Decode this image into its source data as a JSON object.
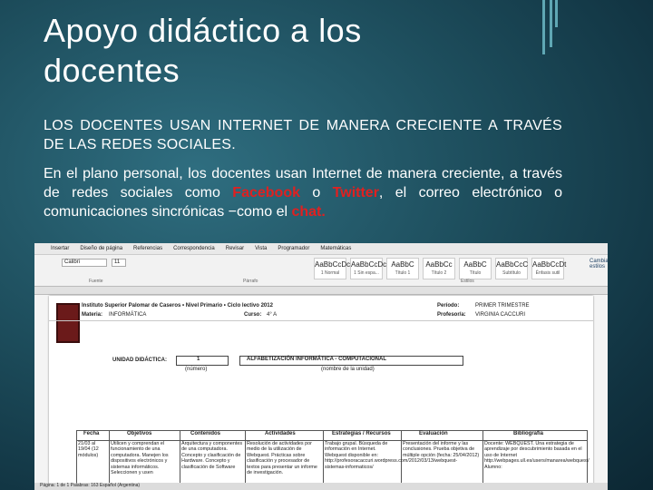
{
  "title": {
    "line1": "Apoyo didáctico a los",
    "line2": "docentes"
  },
  "paragraph1": "LOS DOCENTES USAN INTERNET DE MANERA CRECIENTE A TRAVÉS DE LAS REDES SOCIALES.",
  "paragraph2": {
    "part1": "En el plano personal, los docentes usan Internet de manera creciente, a través de redes sociales como ",
    "facebook": "Facebook",
    "part2": " o ",
    "twitter": "Twitter",
    "part3": ", el correo electrónico o comunicaciones sincrónicas −como el ",
    "chat": "chat."
  },
  "colors": {
    "accent_red": "#e02020",
    "background": "#1d4d5c"
  },
  "screenshot": {
    "tabs": [
      "Insertar",
      "Diseño de página",
      "Referencias",
      "Correspondencia",
      "Revisar",
      "Vista",
      "Programador",
      "Matemáticas"
    ],
    "font_name": "Calibri",
    "font_size": "11",
    "styles": [
      {
        "sample": "AaBbCcDc",
        "name": "1 Normal"
      },
      {
        "sample": "AaBbCcDc",
        "name": "1 Sin espa..."
      },
      {
        "sample": "AaBbC",
        "name": "Título 1"
      },
      {
        "sample": "AaBbCc",
        "name": "Título 2"
      },
      {
        "sample": "AaBbC",
        "name": "Título"
      },
      {
        "sample": "AaBbCcC",
        "name": "Subtítulo"
      },
      {
        "sample": "AaBbCcDt",
        "name": "Énfasis sutil"
      }
    ],
    "groups": {
      "font": "Fuente",
      "paragraph": "Párrafo",
      "styles": "Estilos"
    },
    "change_styles": "Cambiar estilos",
    "institute": "Instituto Superior Palomar de Caseros • Nivel Primario • Ciclo lectivo 2012",
    "materia_label": "Materia:",
    "materia_value": "INFORMÁTICA",
    "curso_label": "Curso:",
    "curso_value": "4° A",
    "periodo_label": "Período:",
    "periodo_value": "PRIMER TRIMESTRE",
    "profesor_label": "Profesor/a:",
    "profesor_value": "VIRGINIA CACCURI",
    "unidad_label": "UNIDAD DIDÁCTICA:",
    "unidad_num": "1",
    "unidad_num_caption": "(número)",
    "unidad_name": "ALFABETIZACIÓN INFORMÁTICA - COMPUTACIONAL",
    "unidad_name_caption": "(nombre de la unidad)",
    "columns": [
      "Fecha",
      "Objetivos",
      "Contenidos",
      "Actividades",
      "Estrategias / Recursos",
      "Evaluación",
      "Bibliografía"
    ],
    "cells": [
      "21/03 al 19/04 (12 módulos)",
      "Utilicen y comprendan el funcionamiento de una computadora. Manejen los dispositivos electrónicos y sistemas informáticos. Seleccionen y usen",
      "Arquitectura y componentes de una computadora. Concepto y clasificación de Hardware. Concepto y clasificación de Software",
      "Resolución de actividades por medio de la utilización de Webquest. Prácticas sobre clasificación y procesador de textos para presentar un informe de investigación.",
      "Trabajo grupal. Búsqueda de información en Internet. Webquest disponible en: http://profesoracaccuri.wordpress.com/2012/03/13/webquest-sistemas-informaticos/",
      "Presentación del informe y las conclusiones. Prueba objetiva de múltiple opción (fecha: 25/04/2012)",
      "Docente: WEBQUEST. Una estrategia de aprendizaje por descubrimiento basada en el uso de Internet http://webpages.ull.es/users/manarea/webquest/ Alumno:"
    ],
    "status": "Página: 1 de 1   Palabras: 163   Español (Argentina)"
  }
}
